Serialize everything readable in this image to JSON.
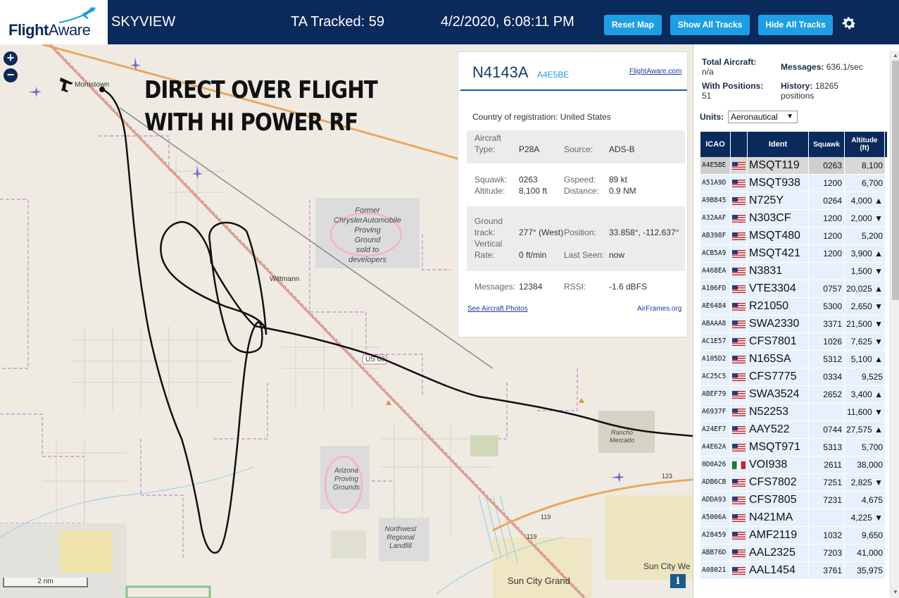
{
  "header": {
    "logo_bold": "Flight",
    "logo_regular": "Aware",
    "app_title": "SKYVIEW",
    "tracked": "TA Tracked: 59",
    "datetime": "4/2/2020, 6:08:11 PM",
    "buttons": {
      "reset": "Reset Map",
      "show": "Show All Tracks",
      "hide": "Hide All Tracks"
    },
    "colors": {
      "bar": "#0b2a5c",
      "button": "#1e9fe3"
    }
  },
  "map": {
    "zoom_in": "+",
    "zoom_out": "−",
    "annotation_line1": "DIRECT OVER FLIGHT",
    "annotation_line2": "WITH HI POWER RF",
    "labels": {
      "morristown": "Morristown",
      "wittmann": "Wittmann",
      "az": "AZ",
      "us60": "US 60",
      "sun_city_grand": "Sun City Grand",
      "sun_city_west": "Sun City We",
      "rancho": "Rancho",
      "mercado": "Mercado",
      "hw119a": "119",
      "hw119b": "119",
      "hw123": "123",
      "chrysler": [
        "Former",
        "ChryslerAutomobile",
        "Proving",
        "Ground",
        "sold to",
        "developers"
      ],
      "arizona": [
        "Arizona",
        "Proving",
        "Grounds"
      ],
      "landfill": [
        "Northwest",
        "Regional",
        "Landfill"
      ]
    },
    "scale": "2 nm",
    "info": "i"
  },
  "popup": {
    "ident": "N4143A",
    "icao": "A4E5BE",
    "fa_link": "FlightAware.com",
    "country_label": "Country of registration:",
    "country": "United States",
    "aircraft_type_label_1": "Aircraft",
    "aircraft_type_label_2": "Type:",
    "aircraft_type": "P28A",
    "source_label": "Source:",
    "source": "ADS-B",
    "squawk_label": "Squawk:",
    "squawk": "0263",
    "gspeed_label": "Gspeed:",
    "gspeed": "89 kt",
    "altitude_label": "Altitude:",
    "altitude": "8,100 ft",
    "distance_label": "Distance:",
    "distance": "0.9 NM",
    "ground_label_1": "Ground",
    "ground_label_2": "track:",
    "ground_track": "277° (West)",
    "position_label": "Position:",
    "position": "33.858°, -112.637°",
    "vertical_label_1": "Vertical",
    "vertical_label_2": "Rate:",
    "vertical_rate": "0 ft/min",
    "last_seen_label": "Last Seen:",
    "last_seen": "now",
    "messages_label": "Messages:",
    "messages": "12384",
    "rssi_label": "RSSI:",
    "rssi": "-1.6 dBFS",
    "photos_link": "See Aircraft Photos",
    "airframes_link": "AirFrames.org"
  },
  "panel": {
    "total_label": "Total Aircraft:",
    "total": "n/a",
    "messages_label": "Messages:",
    "messages": "636.1/sec",
    "positions_label": "With Positions:",
    "positions": "51",
    "history_label": "History:",
    "history": "18265",
    "history_unit": "positions",
    "units_label": "Units:",
    "units_value": "Aeronautical",
    "columns": {
      "icao": "ICAO",
      "ident": "Ident",
      "squawk": "Squawk",
      "alt1": "Altitude",
      "alt2": "(ft)"
    },
    "rows": [
      {
        "icao": "A4E5BE",
        "flag": "us",
        "ident": "MSQT119",
        "squawk": "0263",
        "alt": "8,100",
        "selected": true
      },
      {
        "icao": "A51A9D",
        "flag": "us",
        "ident": "MSQT938",
        "squawk": "1200",
        "alt": "6,700"
      },
      {
        "icao": "A9B845",
        "flag": "us",
        "ident": "N725Y",
        "squawk": "0264",
        "alt": "4,000 ▲"
      },
      {
        "icao": "A32AAF",
        "flag": "us",
        "ident": "N303CF",
        "squawk": "1200",
        "alt": "2,000 ▼"
      },
      {
        "icao": "AB398F",
        "flag": "us",
        "ident": "MSQT480",
        "squawk": "1200",
        "alt": "5,200"
      },
      {
        "icao": "ACB5A9",
        "flag": "us",
        "ident": "MSQT421",
        "squawk": "1200",
        "alt": "3,900 ▲"
      },
      {
        "icao": "A468EA",
        "flag": "us",
        "ident": "N3831",
        "squawk": "",
        "alt": "1,500 ▼"
      },
      {
        "icao": "A106FD",
        "flag": "us",
        "ident": "VTE3304",
        "squawk": "0757",
        "alt": "20,025 ▲"
      },
      {
        "icao": "AE6484",
        "flag": "us",
        "ident": "R21050",
        "squawk": "5300",
        "alt": "2,650 ▼"
      },
      {
        "icao": "ABAAA8",
        "flag": "us",
        "ident": "SWA2330",
        "squawk": "3371",
        "alt": "21,500 ▼"
      },
      {
        "icao": "AC1E57",
        "flag": "us",
        "ident": "CFS7801",
        "squawk": "1026",
        "alt": "7,625 ▼"
      },
      {
        "icao": "A105D2",
        "flag": "us",
        "ident": "N165SA",
        "squawk": "5312",
        "alt": "5,100 ▲"
      },
      {
        "icao": "AC25C5",
        "flag": "us",
        "ident": "CFS7775",
        "squawk": "0334",
        "alt": "9,525"
      },
      {
        "icao": "ABEF79",
        "flag": "us",
        "ident": "SWA3524",
        "squawk": "2652",
        "alt": "3,400 ▲"
      },
      {
        "icao": "A6937F",
        "flag": "us",
        "ident": "N52253",
        "squawk": "",
        "alt": "11,600 ▼"
      },
      {
        "icao": "A24EF7",
        "flag": "us",
        "ident": "AAY522",
        "squawk": "0744",
        "alt": "27,575 ▲"
      },
      {
        "icao": "A4E62A",
        "flag": "us",
        "ident": "MSQT971",
        "squawk": "5313",
        "alt": "5,700"
      },
      {
        "icao": "0D0A26",
        "flag": "mx",
        "ident": "VOI938",
        "squawk": "2611",
        "alt": "38,000"
      },
      {
        "icao": "ADB6CB",
        "flag": "us",
        "ident": "CFS7802",
        "squawk": "7251",
        "alt": "2,825 ▼"
      },
      {
        "icao": "ADDA93",
        "flag": "us",
        "ident": "CFS7805",
        "squawk": "7231",
        "alt": "4,675"
      },
      {
        "icao": "A5006A",
        "flag": "us",
        "ident": "N421MA",
        "squawk": "",
        "alt": "4,225 ▼"
      },
      {
        "icao": "A28459",
        "flag": "us",
        "ident": "AMF2119",
        "squawk": "1032",
        "alt": "9,650"
      },
      {
        "icao": "ABB76D",
        "flag": "us",
        "ident": "AAL2325",
        "squawk": "7203",
        "alt": "41,000"
      },
      {
        "icao": "A08021",
        "flag": "us",
        "ident": "AAL1454",
        "squawk": "3761",
        "alt": "35,975"
      }
    ]
  }
}
